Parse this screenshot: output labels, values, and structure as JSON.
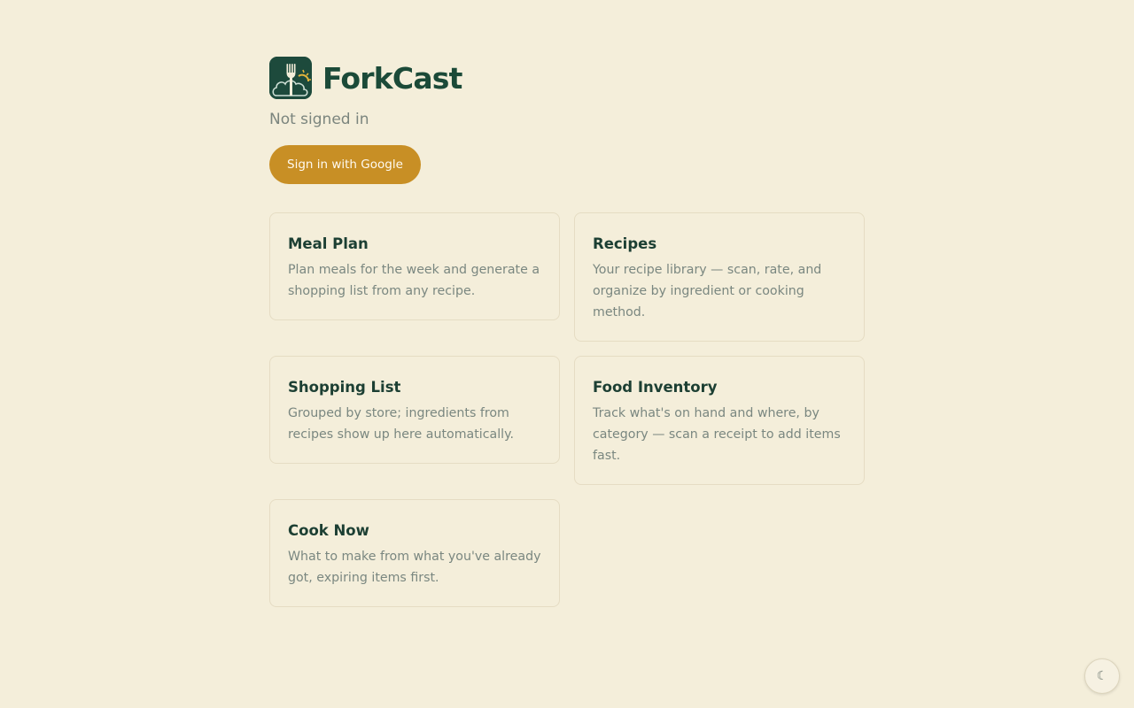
{
  "app": {
    "name": "ForkCast",
    "logo_icon": "fork-sun-cloud-icon"
  },
  "auth": {
    "status": "Not signed in",
    "sign_in_label": "Sign in with Google"
  },
  "cards": [
    {
      "title": "Meal Plan",
      "description": "Plan meals for the week and generate a shopping list from any recipe."
    },
    {
      "title": "Recipes",
      "description": "Your recipe library — scan, rate, and organize by ingredient or cooking method."
    },
    {
      "title": "Shopping List",
      "description": "Grouped by store; ingredients from recipes show up here automatically."
    },
    {
      "title": "Food Inventory",
      "description": "Track what's on hand and where, by category — scan a receipt to add items fast."
    },
    {
      "title": "Cook Now",
      "description": "What to make from what you've already got, expiring items first."
    }
  ],
  "theme_toggle": {
    "glyph": "☾",
    "icon": "moon-icon"
  },
  "colors": {
    "background": "#f4eeda",
    "brand": "#1b4a38",
    "accent": "#c88f25",
    "muted_text": "#7a8780"
  }
}
